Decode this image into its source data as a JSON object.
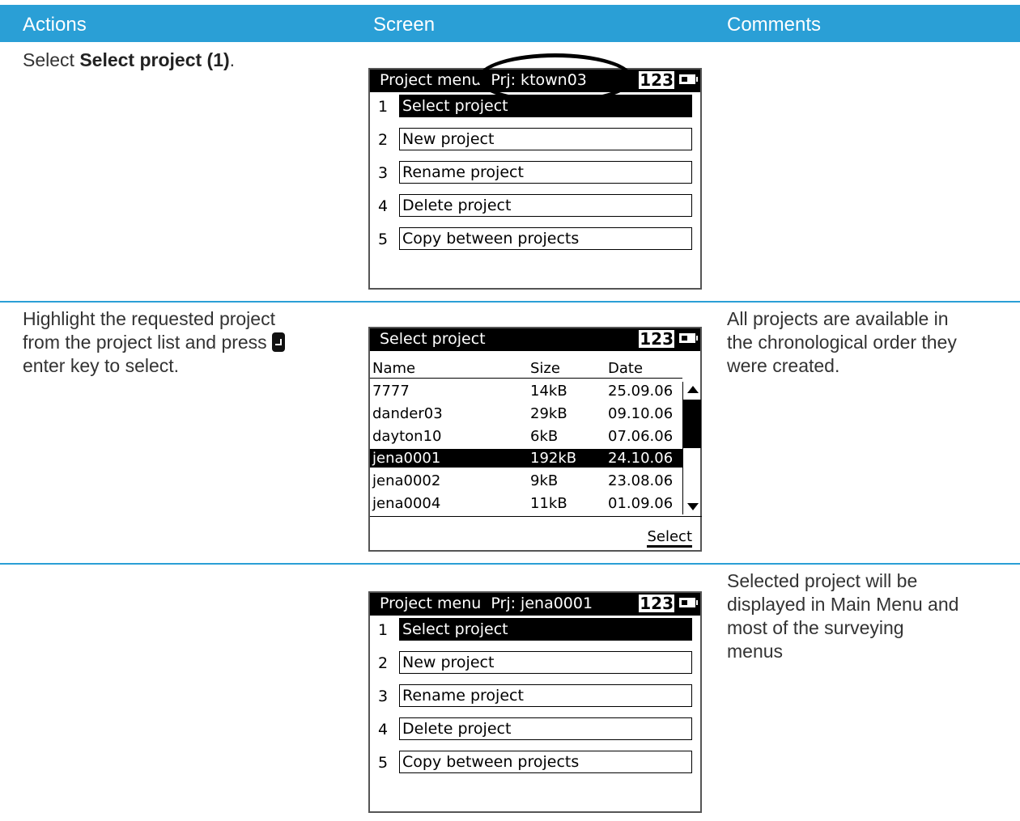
{
  "header": {
    "actions": "Actions",
    "screen": "Screen",
    "comments": "Comments"
  },
  "rows": [
    {
      "action_prefix": "Select ",
      "action_bold": "Select project (1)",
      "action_suffix": ".",
      "comment": ""
    },
    {
      "action_line1": "Highlight the requested project",
      "action_line2": "from the project list and press",
      "action_line3": "enter key to select.",
      "comment_line1": "All projects are available in",
      "comment_line2": "the chronological order they",
      "comment_line3": "were created."
    },
    {
      "comment_line1": "Selected project will be",
      "comment_line2": "displayed in Main Menu and",
      "comment_line3": "most of the surveying",
      "comment_line4": "menus"
    }
  ],
  "screen1": {
    "title": "Project menu  Prj: ktown03",
    "mode": "123",
    "items": [
      {
        "num": "1",
        "label": "Select project"
      },
      {
        "num": "2",
        "label": "New project"
      },
      {
        "num": "3",
        "label": "Rename project"
      },
      {
        "num": "4",
        "label": "Delete project"
      },
      {
        "num": "5",
        "label": "Copy between projects"
      }
    ]
  },
  "screen2": {
    "title": "Select project",
    "mode": "123",
    "columns": [
      "Name",
      "Size",
      "Date"
    ],
    "rows": [
      {
        "name": "7777",
        "size": "14kB",
        "date": "25.09.06"
      },
      {
        "name": "dander03",
        "size": "29kB",
        "date": "09.10.06"
      },
      {
        "name": "dayton10",
        "size": "6kB",
        "date": "07.06.06"
      },
      {
        "name": "jena0001",
        "size": "192kB",
        "date": "24.10.06"
      },
      {
        "name": "jena0002",
        "size": "9kB",
        "date": "23.08.06"
      },
      {
        "name": "jena0004",
        "size": "11kB",
        "date": "01.09.06"
      }
    ],
    "softkey": "Select"
  },
  "screen3": {
    "title": "Project menu  Prj: jena0001",
    "mode": "123",
    "items": [
      {
        "num": "1",
        "label": "Select project"
      },
      {
        "num": "2",
        "label": "New project"
      },
      {
        "num": "3",
        "label": "Rename project"
      },
      {
        "num": "4",
        "label": "Delete project"
      },
      {
        "num": "5",
        "label": "Copy between projects"
      }
    ]
  }
}
